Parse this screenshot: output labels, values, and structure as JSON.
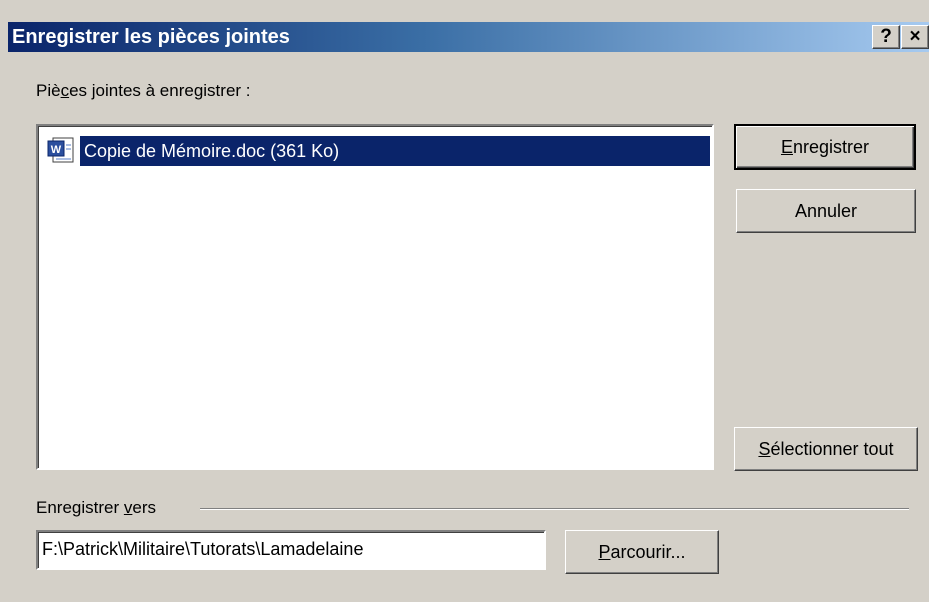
{
  "window": {
    "title": "Enregistrer les pièces jointes",
    "help_label": "?",
    "close_label": "×"
  },
  "attachments": {
    "label_before": "Piè",
    "label_underlined": "c",
    "label_after": "es jointes à enregistrer :",
    "items": [
      {
        "name": "Copie de Mémoire.doc (361 Ko)",
        "icon": "word-document-icon",
        "selected": true
      }
    ]
  },
  "buttons": {
    "save_underlined": "E",
    "save_rest": "nregistrer",
    "cancel": "Annuler",
    "selectall_underlined": "S",
    "selectall_rest": "électionner tout",
    "browse_underlined": "P",
    "browse_rest": "arcourir..."
  },
  "destination": {
    "label_before": "Enregistrer ",
    "label_underlined": "v",
    "label_after": "ers",
    "path": "F:\\Patrick\\Militaire\\Tutorats\\Lamadelaine"
  },
  "colors": {
    "title_bar_start": "#0a246a",
    "title_bar_end": "#a6caf0",
    "selection": "#0a246a",
    "face": "#d4d0c8"
  }
}
